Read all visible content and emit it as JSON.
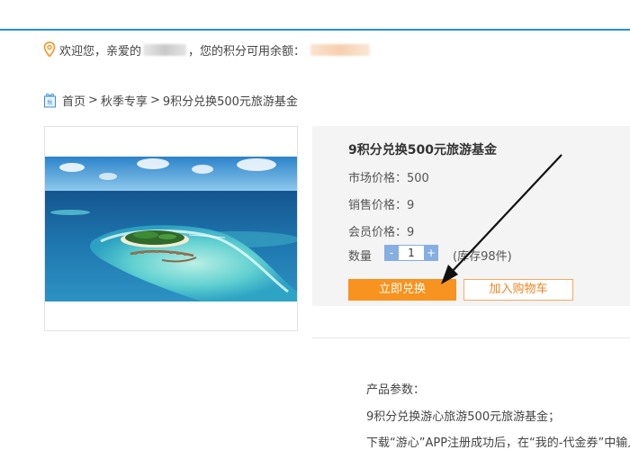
{
  "header": {
    "welcome_prefix": "欢迎您，亲爱的",
    "welcome_suffix": "，您的积分可用余额："
  },
  "breadcrumb": {
    "home": "首页",
    "sep1": ">",
    "category": "秋季专享",
    "sep2": ">",
    "current": "9积分兑换500元旅游基金"
  },
  "product": {
    "title": "9积分兑换500元旅游基金",
    "market_price": "市场价格：500",
    "sale_price": "销售价格：9",
    "member_price": "会员价格：9",
    "quantity_label": "数量",
    "quantity_value": "1",
    "minus": "-",
    "plus": "+",
    "stock": "(库存98件)",
    "buy_label": "立即兑换",
    "cart_label": "加入购物车"
  },
  "description": {
    "heading": "产品参数：",
    "line1": "9积分兑换游心旅游500元旅游基金；",
    "line2": "下载“游心”APP注册成功后，在“我的-代金券”中输入"
  },
  "colors": {
    "accent_blue": "#2b8fd6",
    "button_orange": "#f7931e",
    "stepper_blue": "#86aee0"
  }
}
